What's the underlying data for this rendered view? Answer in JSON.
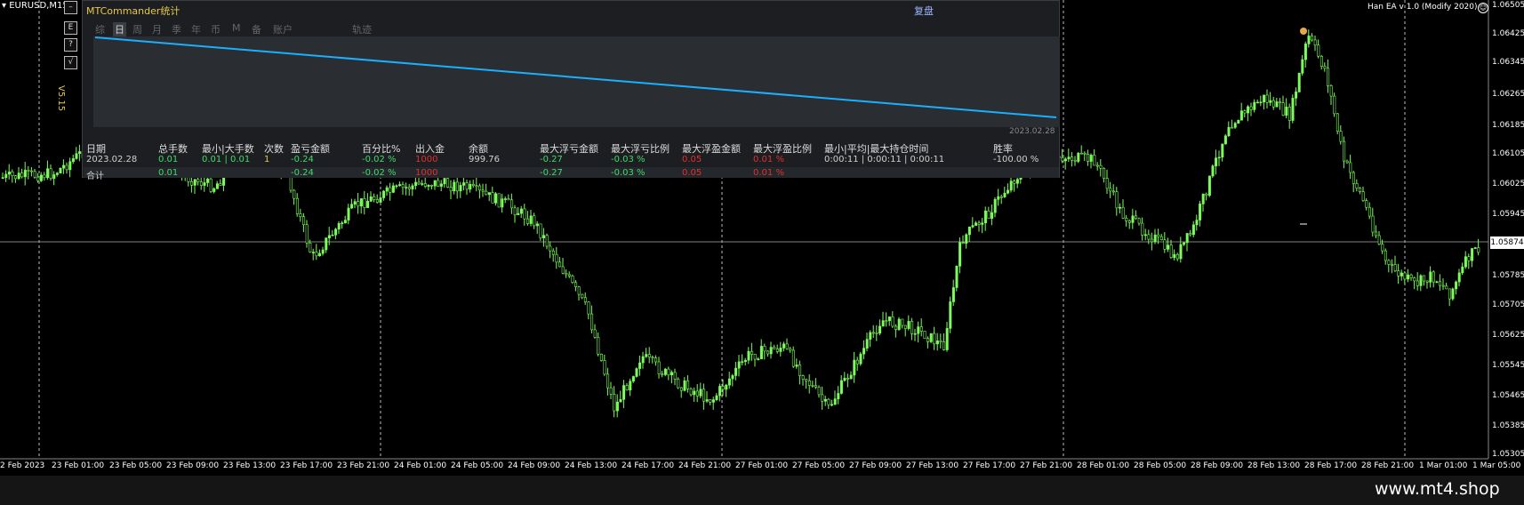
{
  "symbol": "EURUSD,M15",
  "ea_label": "Han EA  v 1.0 (Modify 2020)",
  "side_buttons": [
    "E",
    "?",
    "√"
  ],
  "version": "V5.15",
  "panel": {
    "title": "MTCommander统计",
    "right_label": "复盘",
    "tabs": [
      "综",
      "日",
      "周",
      "月",
      "季",
      "年",
      "币",
      "M",
      "备",
      "账户",
      "轨迹"
    ],
    "active_tab": "日",
    "chart_date": "2023.02.28",
    "headers": [
      "日期",
      "总手数",
      "最小|大手数",
      "次数",
      "盈亏金额",
      "百分比%",
      "出入金",
      "余额",
      "最大浮亏金额",
      "最大浮亏比例",
      "最大浮盈金额",
      "最大浮盈比例",
      "最小|平均|最大持仓时间",
      "胜率"
    ],
    "rows": [
      [
        "2023.02.28",
        "0.01",
        "0.01 | 0.01",
        "1",
        "-0.24",
        "-0.02 %",
        "1000",
        "999.76",
        "-0.27",
        "-0.03 %",
        "0.05",
        "0.01 %",
        "0:00:11 | 0:00:11 | 0:00:11",
        "-100.00 %"
      ],
      [
        "合计",
        "0.01",
        "",
        "",
        "-0.24",
        "-0.02 %",
        "1000",
        "",
        "-0.27",
        "-0.03 %",
        "0.05",
        "0.01 %",
        "",
        ""
      ]
    ]
  },
  "price_axis": [
    "1.06505",
    "1.06425",
    "1.06345",
    "1.06265",
    "1.06185",
    "1.06105",
    "1.06025",
    "1.05945",
    "1.05874",
    "1.05785",
    "1.05705",
    "1.05625",
    "1.05545",
    "1.05465",
    "1.05385",
    "1.05305"
  ],
  "current_price": "1.05874",
  "time_axis": [
    "2 Feb 2023",
    "23 Feb 01:00",
    "23 Feb 05:00",
    "23 Feb 09:00",
    "23 Feb 13:00",
    "23 Feb 17:00",
    "23 Feb 21:00",
    "24 Feb 01:00",
    "24 Feb 05:00",
    "24 Feb 09:00",
    "24 Feb 13:00",
    "24 Feb 17:00",
    "24 Feb 21:00",
    "27 Feb 01:00",
    "27 Feb 05:00",
    "27 Feb 09:00",
    "27 Feb 13:00",
    "27 Feb 17:00",
    "27 Feb 21:00",
    "28 Feb 01:00",
    "28 Feb 05:00",
    "28 Feb 09:00",
    "28 Feb 13:00",
    "28 Feb 17:00",
    "28 Feb 21:00",
    "1 Mar 01:00",
    "1 Mar 05:00"
  ],
  "watermark": "www.mt4.shop",
  "colors": {
    "candle": "#7CFC5A",
    "equity_line": "#1ab0ff",
    "panel_bg": "#1c1e22",
    "gold": "#e6c84a",
    "positive": "#3fdc6a",
    "negative": "#e03030"
  }
}
